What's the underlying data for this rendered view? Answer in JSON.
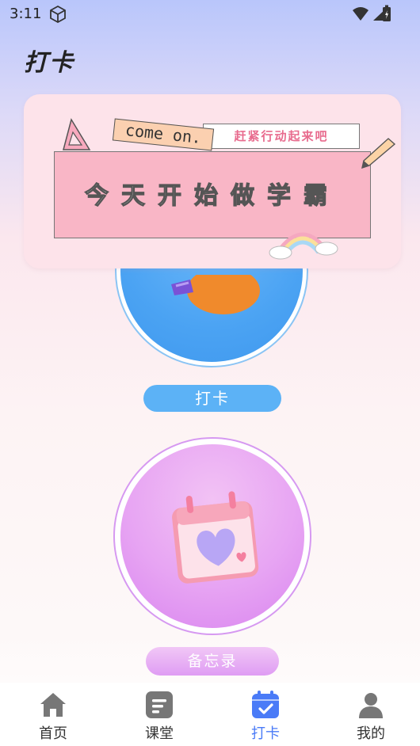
{
  "status_bar": {
    "time": "3:11"
  },
  "page": {
    "title": "打卡"
  },
  "banner": {
    "tag_left": "come on.",
    "tag_right": "赶紧行动起来吧",
    "headline": "今天开始做学霸"
  },
  "actions": {
    "punch_label": "打卡",
    "memo_label": "备忘录"
  },
  "bottom_nav": {
    "active_index": 2,
    "active_color": "#4a7bf7",
    "items": [
      {
        "label": "首页",
        "icon": "home-icon"
      },
      {
        "label": "课堂",
        "icon": "classroom-icon"
      },
      {
        "label": "打卡",
        "icon": "calendar-check-icon"
      },
      {
        "label": "我的",
        "icon": "user-icon"
      }
    ]
  }
}
